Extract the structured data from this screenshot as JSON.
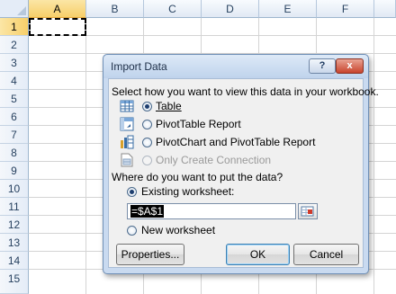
{
  "spreadsheet": {
    "columns": [
      "A",
      "B",
      "C",
      "D",
      "E",
      "F"
    ],
    "rows": [
      "1",
      "2",
      "3",
      "4",
      "5",
      "6",
      "7",
      "8",
      "9",
      "10",
      "11",
      "12",
      "13",
      "14",
      "15"
    ],
    "active_column": "A",
    "active_row": "1"
  },
  "dialog": {
    "title": "Import Data",
    "help_label": "?",
    "close_label": "x",
    "view_prompt": "Select how you want to view this data in your workbook.",
    "view_options": [
      {
        "label": "Table",
        "checked": true,
        "icon": "table-icon"
      },
      {
        "label": "PivotTable Report",
        "checked": false,
        "icon": "pivottable-icon"
      },
      {
        "label": "PivotChart and PivotTable Report",
        "checked": false,
        "icon": "pivotchart-icon"
      },
      {
        "label": "Only Create Connection",
        "checked": false,
        "disabled": true,
        "icon": "connection-icon"
      }
    ],
    "location_prompt": "Where do you want to put the data?",
    "existing_worksheet_label": "Existing worksheet:",
    "existing_worksheet_checked": true,
    "cell_reference_value": "=$A$1",
    "new_worksheet_label": "New worksheet",
    "properties_button": "Properties...",
    "ok_button": "OK",
    "cancel_button": "Cancel"
  }
}
